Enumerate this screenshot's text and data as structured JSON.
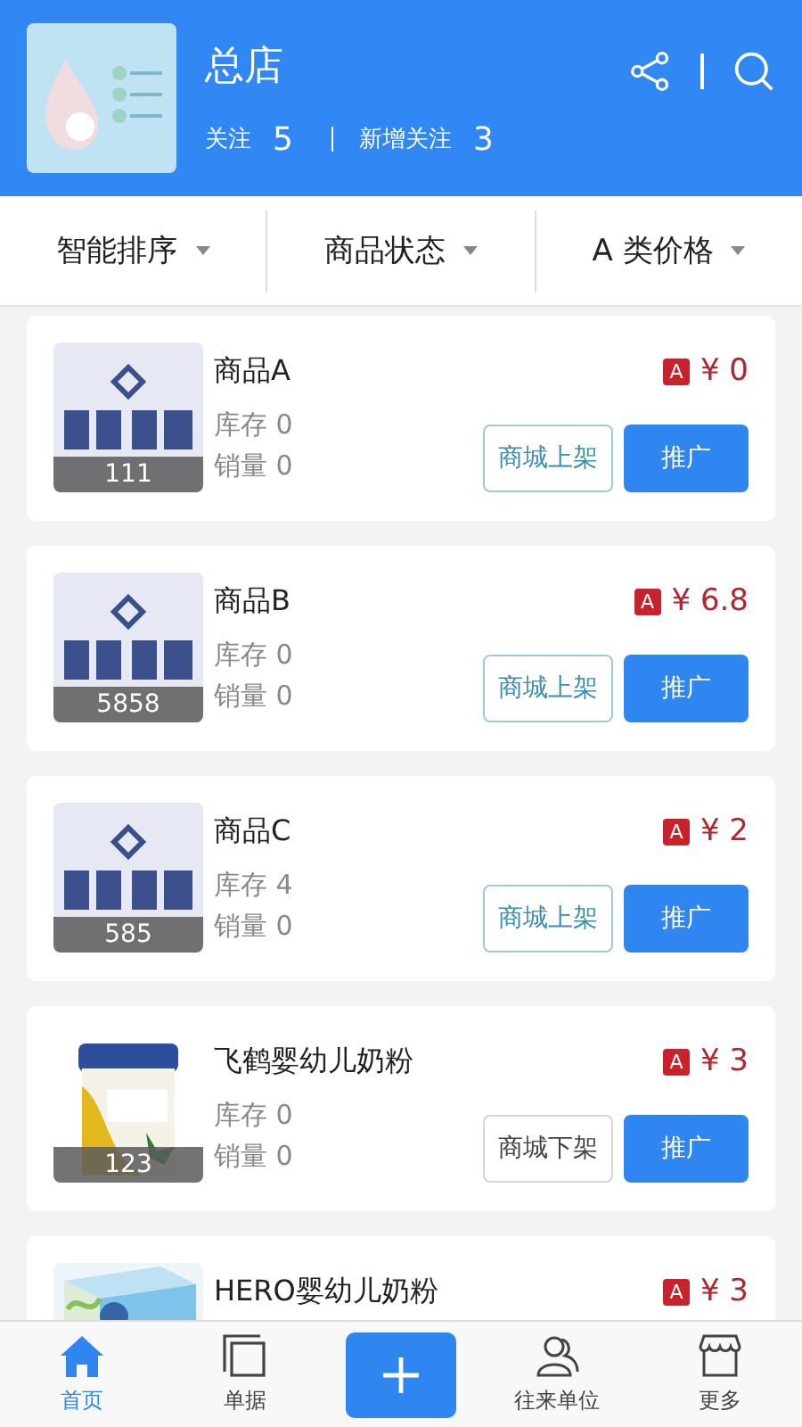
{
  "store": {
    "name": "总店",
    "follow_label": "关注",
    "follow_count": "5",
    "new_follow_label": "新增关注",
    "new_follow_count": "3"
  },
  "filters": [
    {
      "label": "智能排序"
    },
    {
      "label": "商品状态"
    },
    {
      "label": "A 类价格"
    }
  ],
  "products": [
    {
      "name": "商品A",
      "image": {
        "kind": "logo"
      },
      "image_count": "111",
      "stock": "库存 0",
      "sales": "销量 0",
      "price_tag": "A",
      "price": "¥ 0",
      "shelf_button": "商城上架",
      "listed": false,
      "promote_button": "推广"
    },
    {
      "name": "商品B",
      "image": {
        "kind": "logo"
      },
      "image_count": "5858",
      "stock": "库存 0",
      "sales": "销量 0",
      "price_tag": "A",
      "price": "¥ 6.8",
      "shelf_button": "商城上架",
      "listed": false,
      "promote_button": "推广"
    },
    {
      "name": "商品C",
      "image": {
        "kind": "logo"
      },
      "image_count": "585",
      "stock": "库存 4",
      "sales": "销量 0",
      "price_tag": "A",
      "price": "¥ 2",
      "shelf_button": "商城上架",
      "listed": false,
      "promote_button": "推广"
    },
    {
      "name": "飞鹤婴幼儿奶粉",
      "image": {
        "kind": "can"
      },
      "image_count": "123",
      "stock": "库存 0",
      "sales": "销量 0",
      "price_tag": "A",
      "price": "¥ 3",
      "shelf_button": "商城下架",
      "listed": true,
      "promote_button": "推广"
    },
    {
      "name": "HERO婴幼儿奶粉",
      "image": {
        "kind": "box"
      },
      "price_tag": "A",
      "price": "¥ 3"
    }
  ],
  "tabs": [
    {
      "label": "首页",
      "kind": "home",
      "selected": true
    },
    {
      "label": "单据",
      "kind": "docs",
      "selected": false
    },
    {
      "kind": "plus",
      "selected": false
    },
    {
      "label": "往来单位",
      "kind": "people",
      "selected": false
    },
    {
      "label": "更多",
      "kind": "store",
      "selected": false
    }
  ]
}
